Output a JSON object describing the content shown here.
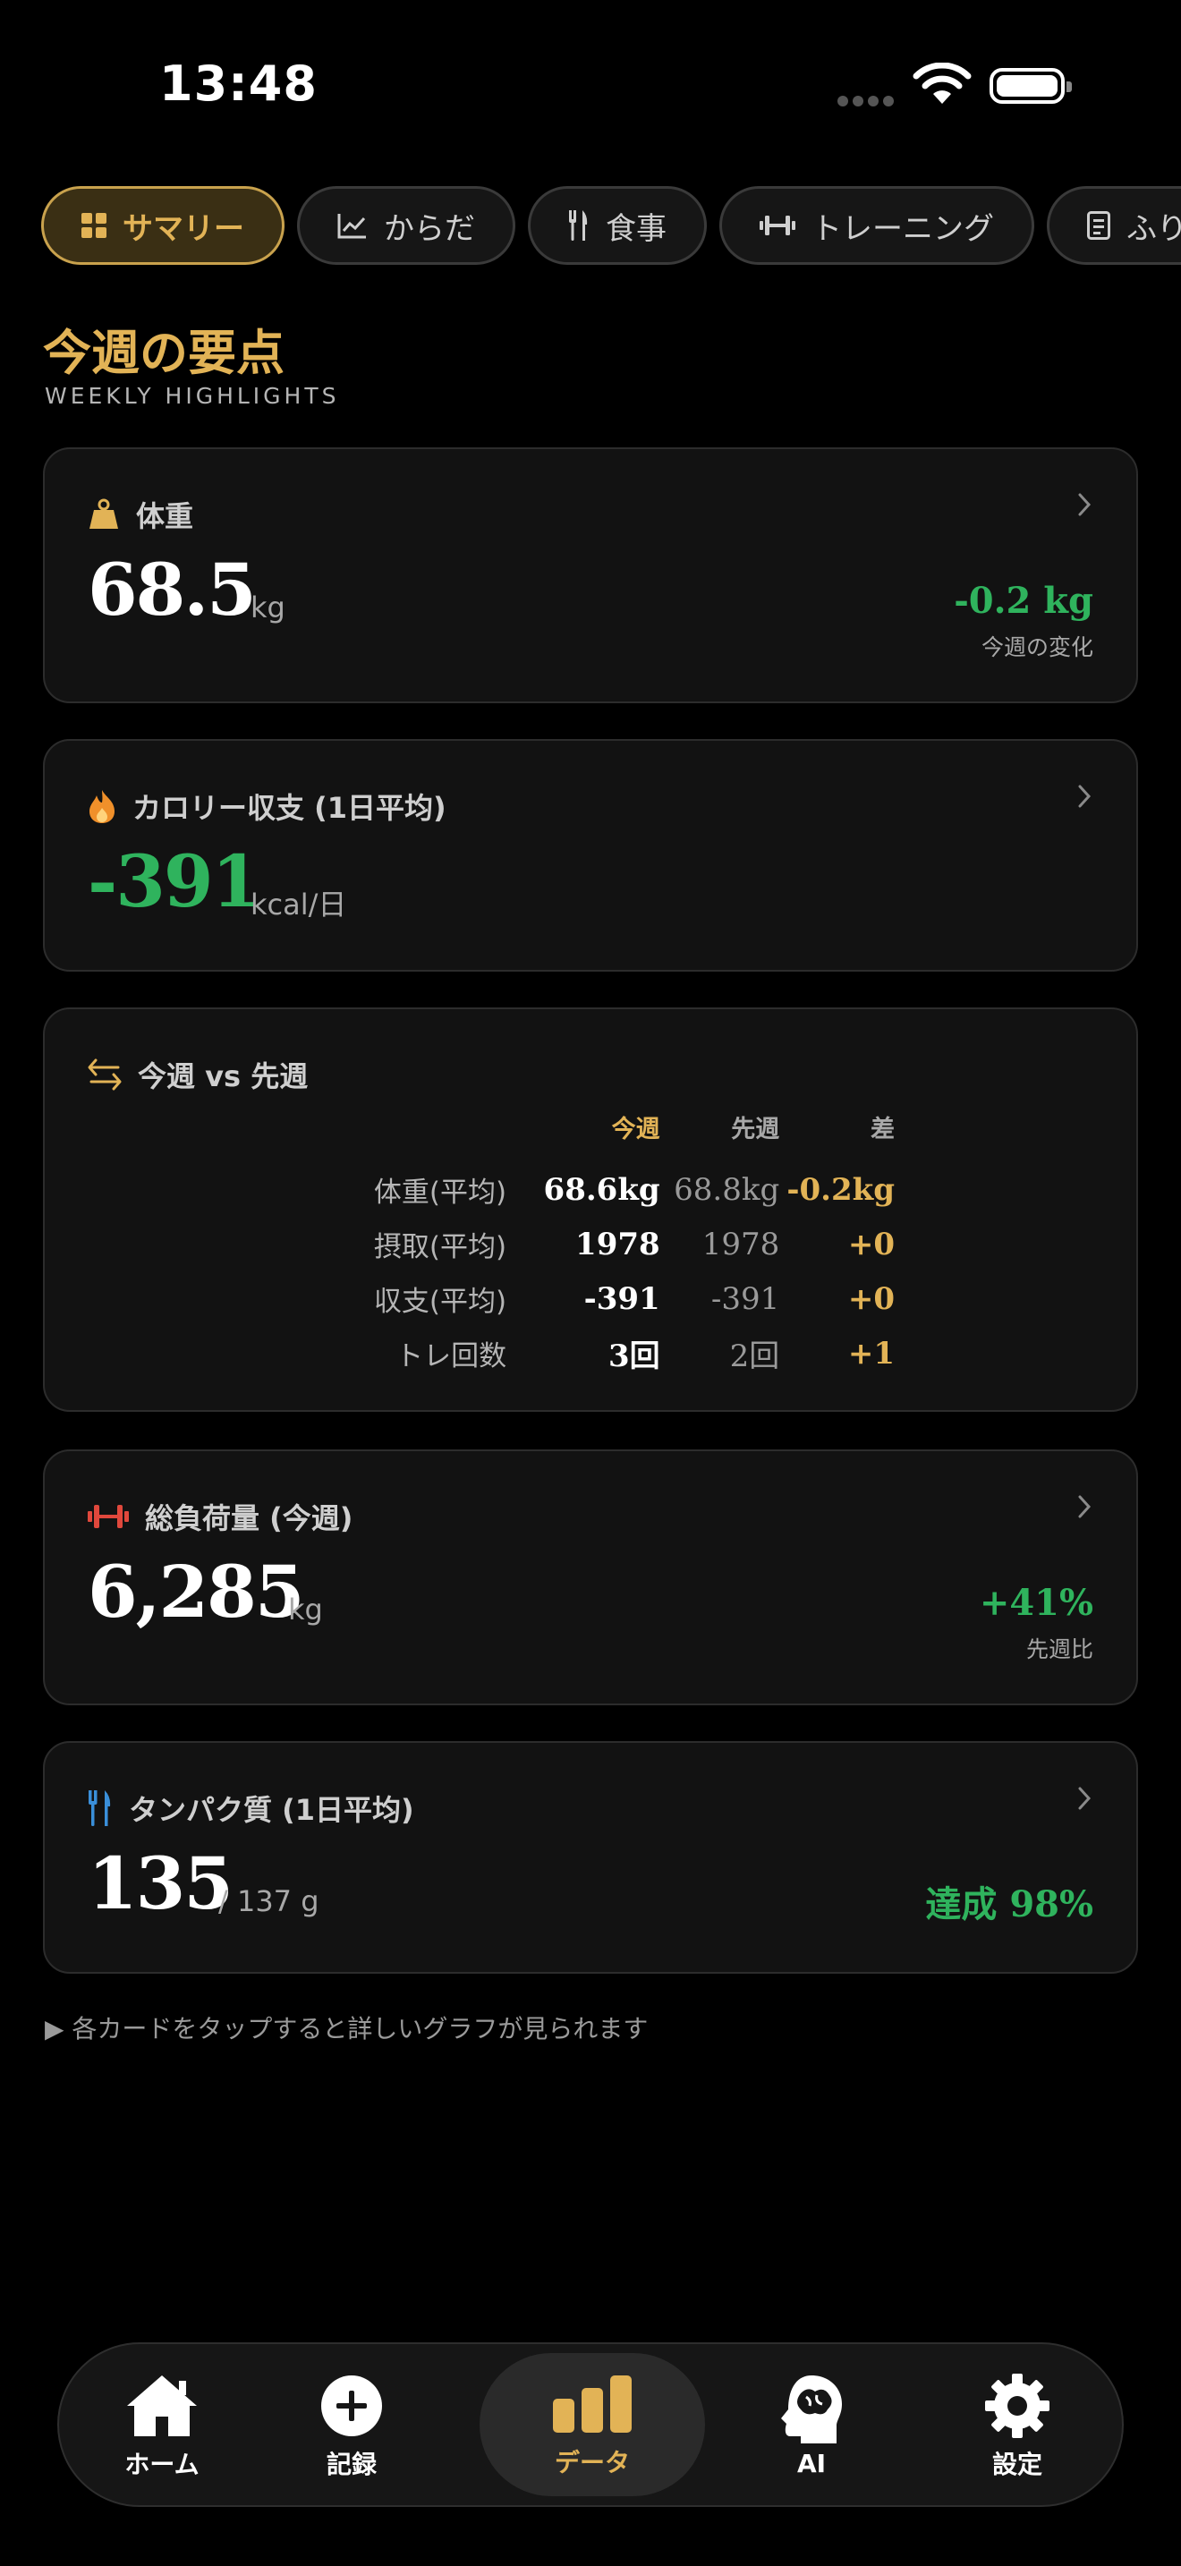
{
  "status_bar": {
    "time": "13:48"
  },
  "tabs": [
    {
      "label": "サマリー",
      "icon": "grid-icon",
      "active": true
    },
    {
      "label": "からだ",
      "icon": "chart-line-icon",
      "active": false
    },
    {
      "label": "食事",
      "icon": "utensils-icon",
      "active": false
    },
    {
      "label": "トレーニング",
      "icon": "dumbbell-icon",
      "active": false
    },
    {
      "label": "ふり",
      "icon": "document-icon",
      "active": false
    }
  ],
  "heading": {
    "title": "今週の要点",
    "subtitle": "WEEKLY HIGHLIGHTS"
  },
  "weight_card": {
    "title": "体重",
    "value": "68.5",
    "unit": "kg",
    "delta": "-0.2 kg",
    "delta_label": "今週の変化"
  },
  "calorie_card": {
    "title": "カロリー収支 (1日平均)",
    "value": "-391",
    "unit": "kcal/日"
  },
  "compare_card": {
    "title": "今週 vs 先週",
    "headers": {
      "current": "今週",
      "previous": "先週",
      "diff": "差"
    },
    "rows": [
      {
        "label": "体重(平均)",
        "current": "68.6kg",
        "previous": "68.8kg",
        "diff": "-0.2kg"
      },
      {
        "label": "摂取(平均)",
        "current": "1978",
        "previous": "1978",
        "diff": "+0"
      },
      {
        "label": "収支(平均)",
        "current": "-391",
        "previous": "-391",
        "diff": "+0"
      },
      {
        "label": "トレ回数",
        "current": "3回",
        "previous": "2回",
        "diff": "+1"
      }
    ]
  },
  "volume_card": {
    "title": "総負荷量 (今週)",
    "value": "6,285",
    "unit": "kg",
    "delta": "+41%",
    "delta_label": "先週比"
  },
  "protein_card": {
    "title": "タンパク質 (1日平均)",
    "value": "135",
    "unit": "/ 137 g",
    "achievement": "達成 98%"
  },
  "hint": "▶ 各カードをタップすると詳しいグラフが見られます",
  "nav": [
    {
      "label": "ホーム",
      "icon": "home-icon"
    },
    {
      "label": "記録",
      "icon": "plus-circle-icon"
    },
    {
      "label": "データ",
      "icon": "bar-chart-icon",
      "active": true
    },
    {
      "label": "AI",
      "icon": "brain-head-icon"
    },
    {
      "label": "設定",
      "icon": "gear-icon"
    }
  ],
  "colors": {
    "accent": "#e2b356",
    "positive": "#2fb35d",
    "background": "#000000",
    "card": "#121212"
  }
}
